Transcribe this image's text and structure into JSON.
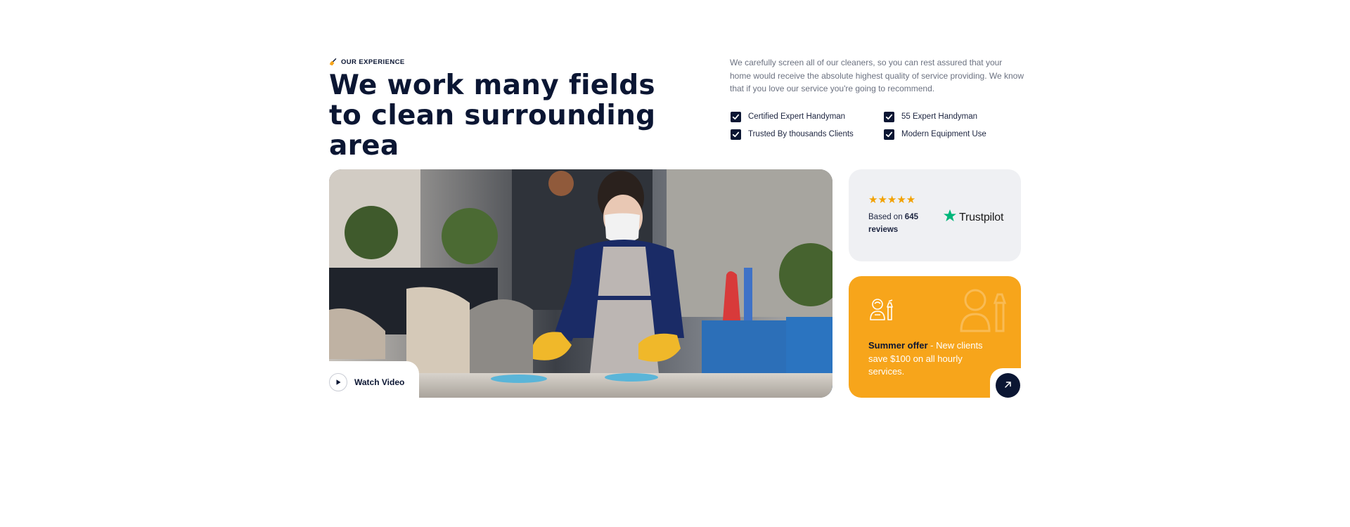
{
  "header": {
    "eyebrow": "OUR EXPERIENCE",
    "title": "We work many fields to clean surrounding area"
  },
  "intro": {
    "text": "We carefully screen all of our cleaners, so you can rest assured that your home would receive the absolute highest quality of service providing. We know that if you love our service you're going to recommend."
  },
  "features": [
    "Certified Expert Handyman",
    "55 Expert Handyman",
    "Trusted By thousands Clients",
    "Modern Equipment Use"
  ],
  "video": {
    "label": "Watch Video"
  },
  "reviews": {
    "stars": "★★★★★",
    "rating": 5,
    "prefix": "Based on ",
    "count": "645",
    "suffix": "reviews",
    "brand": "Trustpilot"
  },
  "offer": {
    "title": "Summer offer",
    "body": " - New clients save $100 on all hourly services."
  },
  "colors": {
    "navy": "#0b1633",
    "accent": "#f7a51b",
    "trustpilot_green": "#00b67a",
    "card_gray": "#eff0f3"
  },
  "icons": {
    "eyebrow": "broom-icon",
    "check": "checkbox-checked-icon",
    "play": "play-icon",
    "trustpilot": "trustpilot-star-icon",
    "offer": "cleaner-with-spray-icon",
    "arrow": "arrow-up-right-icon"
  }
}
